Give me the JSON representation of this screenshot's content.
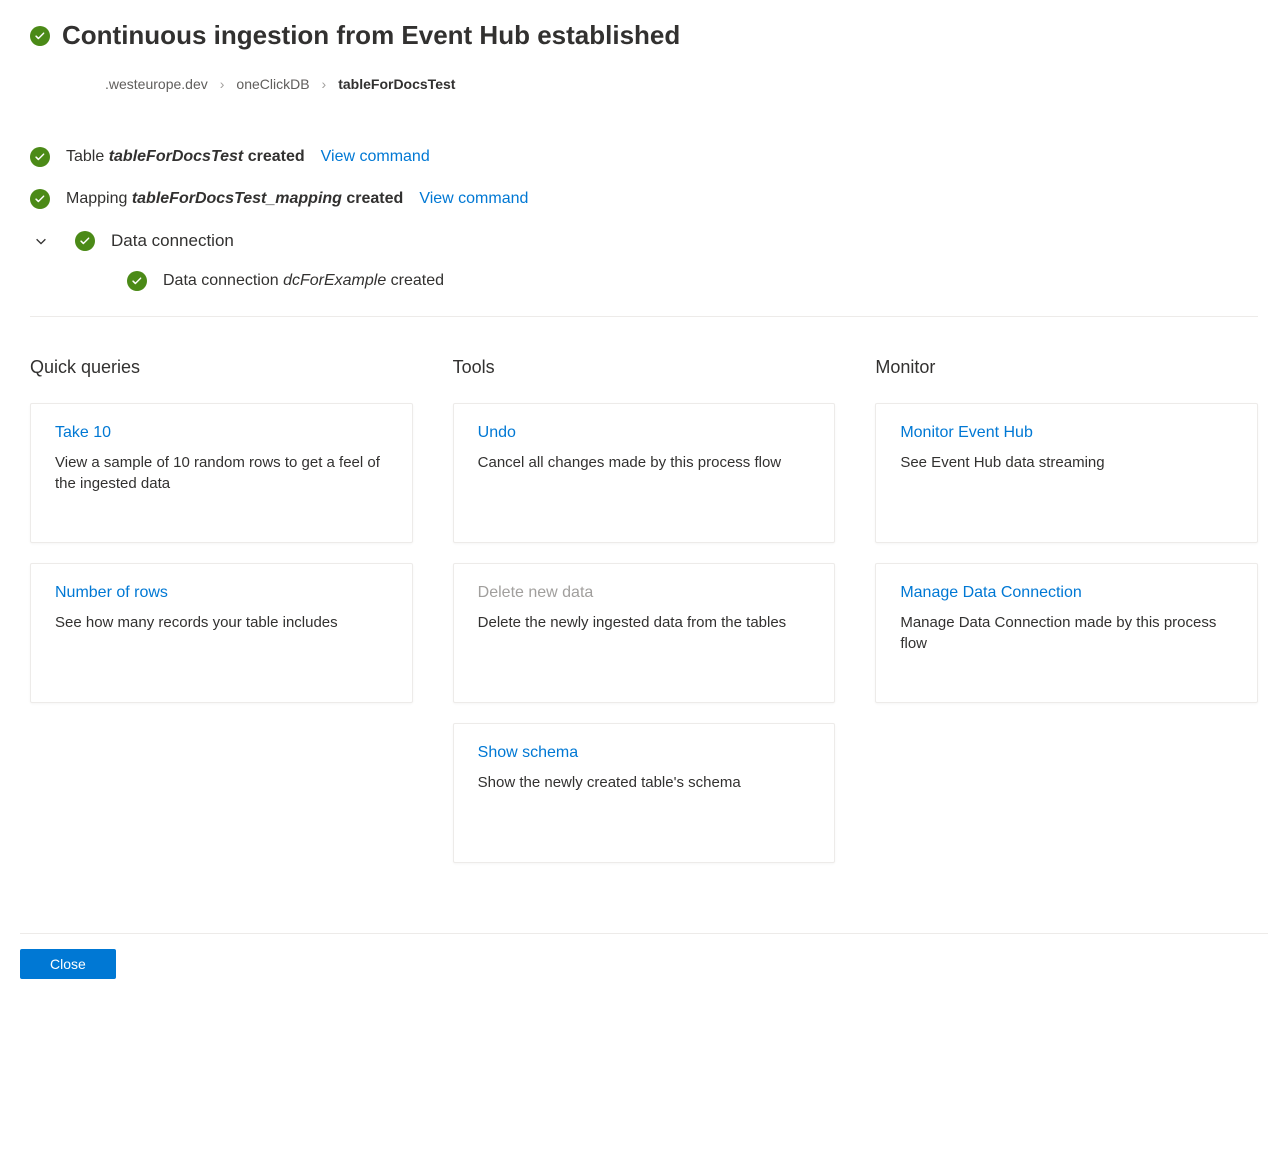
{
  "header": {
    "title": "Continuous ingestion from Event Hub established"
  },
  "breadcrumb": {
    "items": [
      {
        "label": ".westeurope.dev",
        "current": false
      },
      {
        "label": "oneClickDB",
        "current": false
      },
      {
        "label": "tableForDocsTest",
        "current": true
      }
    ]
  },
  "status": {
    "table_created": {
      "prefix": "Table ",
      "name": "tableForDocsTest",
      "suffix": " created",
      "view_command": "View command"
    },
    "mapping_created": {
      "prefix": "Mapping ",
      "name": "tableForDocsTest_mapping",
      "suffix": " created",
      "view_command": "View command"
    },
    "data_connection": {
      "label": "Data connection",
      "sub": {
        "prefix": "Data connection ",
        "name": "dcForExample",
        "suffix": " created"
      }
    }
  },
  "columns": {
    "quick_queries": {
      "title": "Quick queries",
      "cards": [
        {
          "title": "Take 10",
          "desc": "View a sample of 10 random rows to get a feel of the ingested data",
          "disabled": false
        },
        {
          "title": "Number of rows",
          "desc": "See how many records your table includes",
          "disabled": false
        }
      ]
    },
    "tools": {
      "title": "Tools",
      "cards": [
        {
          "title": "Undo",
          "desc": "Cancel all changes made by this process flow",
          "disabled": false
        },
        {
          "title": "Delete new data",
          "desc": "Delete the newly ingested data from the tables",
          "disabled": true
        },
        {
          "title": "Show schema",
          "desc": "Show the newly created table's schema",
          "disabled": false
        }
      ]
    },
    "monitor": {
      "title": "Monitor",
      "cards": [
        {
          "title": "Monitor Event Hub",
          "desc": "See Event Hub data streaming",
          "disabled": false
        },
        {
          "title": "Manage Data Connection",
          "desc": "Manage Data Connection made by this process flow",
          "disabled": false
        }
      ]
    }
  },
  "footer": {
    "close": "Close"
  }
}
